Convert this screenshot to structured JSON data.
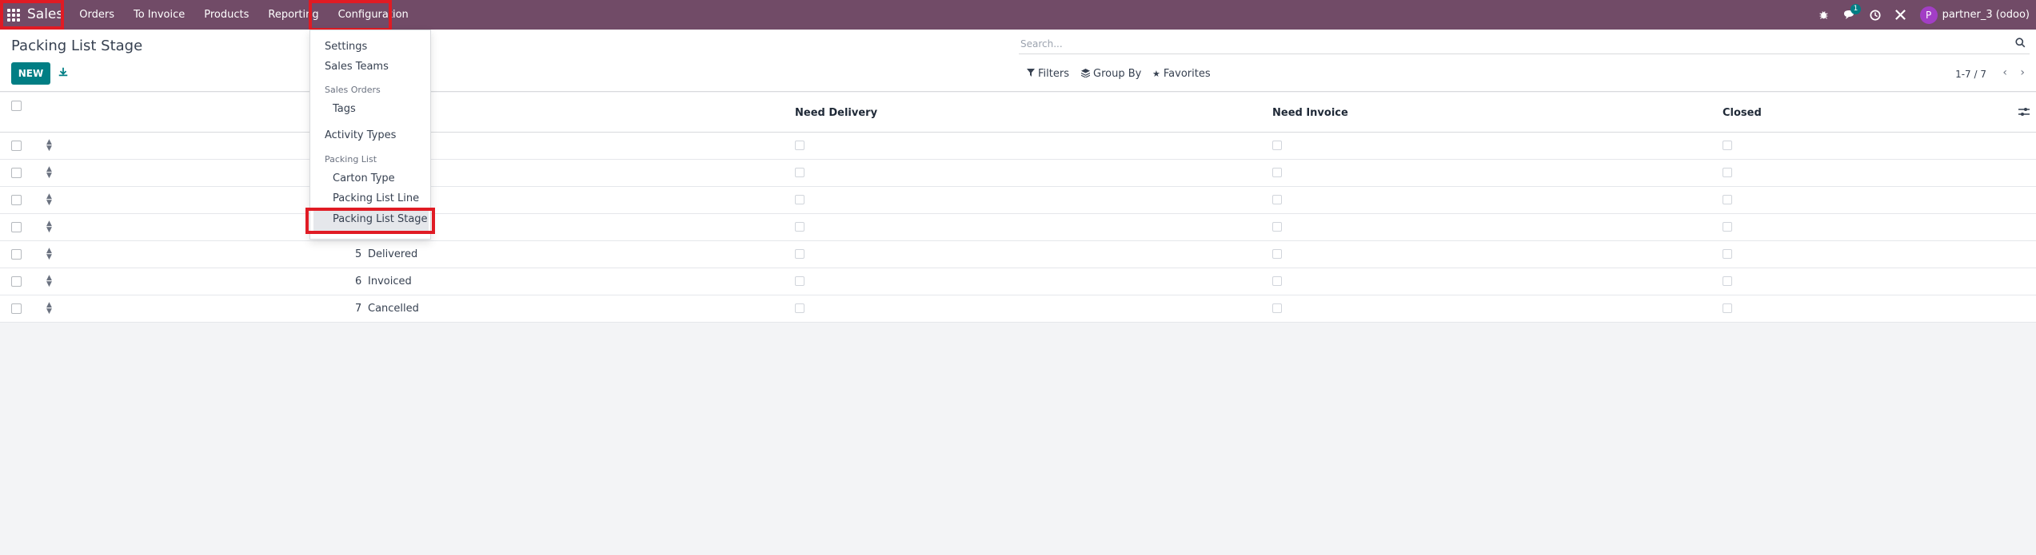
{
  "navbar": {
    "app_name": "Sales",
    "menu": [
      "Orders",
      "To Invoice",
      "Products",
      "Reporting",
      "Configuration"
    ],
    "chat_count": "1",
    "avatar_initial": "P",
    "user_name": "partner_3 (odoo)"
  },
  "control_panel": {
    "title": "Packing List Stage",
    "new_label": "NEW",
    "search_placeholder": "Search...",
    "filters_label": "Filters",
    "group_by_label": "Group By",
    "favorites_label": "Favorites",
    "pager": "1-7 / 7"
  },
  "list": {
    "columns": [
      "Need Delivery",
      "Need Invoice",
      "Closed"
    ],
    "rows": [
      {
        "seq": "",
        "name": ""
      },
      {
        "seq": "",
        "name": ""
      },
      {
        "seq": "",
        "name": ""
      },
      {
        "seq": "",
        "name": ""
      },
      {
        "seq": "5",
        "name": "Delivered"
      },
      {
        "seq": "6",
        "name": "Invoiced"
      },
      {
        "seq": "7",
        "name": "Cancelled"
      }
    ]
  },
  "dropdown": {
    "settings": "Settings",
    "sales_teams": "Sales Teams",
    "section_sales_orders": "Sales Orders",
    "tags": "Tags",
    "activity_types": "Activity Types",
    "section_packing_list": "Packing List",
    "carton_type": "Carton Type",
    "packing_list_line": "Packing List Line",
    "packing_list_stage": "Packing List Stage"
  },
  "colors": {
    "navbar": "#714b67",
    "primary": "#017e84",
    "highlight": "#e01b24"
  }
}
